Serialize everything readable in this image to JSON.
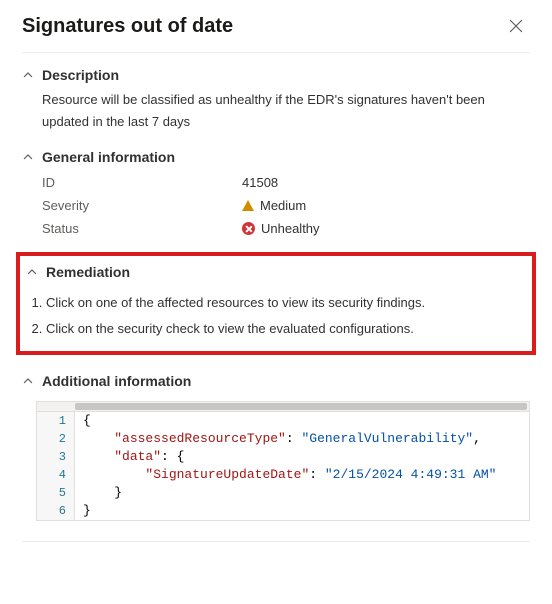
{
  "header": {
    "title": "Signatures out of date"
  },
  "sections": {
    "description": {
      "label": "Description",
      "text": "Resource will be classified as unhealthy if the EDR's signatures haven't been updated in the last 7 days"
    },
    "general": {
      "label": "General information",
      "rows": {
        "id": {
          "key": "ID",
          "value": "41508"
        },
        "severity": {
          "key": "Severity",
          "value": "Medium"
        },
        "status": {
          "key": "Status",
          "value": "Unhealthy"
        }
      }
    },
    "remediation": {
      "label": "Remediation",
      "steps": [
        "Click on one of the affected resources to view its security findings.",
        "Click on the security check to view the evaluated configurations."
      ]
    },
    "additional": {
      "label": "Additional information",
      "json": {
        "assessedResourceType": "GeneralVulnerability",
        "data": {
          "SignatureUpdateDate": "2/15/2024 4:49:31 AM"
        }
      },
      "lines": [
        "1",
        "2",
        "3",
        "4",
        "5",
        "6"
      ],
      "tokens": {
        "l1": "{",
        "l2_k": "\"assessedResourceType\"",
        "l2_v": "\"GeneralVulnerability\"",
        "l3_k": "\"data\"",
        "l4_k": "\"SignatureUpdateDate\"",
        "l4_v": "\"2/15/2024 4:49:31 AM\"",
        "l5": "    }",
        "l6": "}"
      }
    }
  }
}
